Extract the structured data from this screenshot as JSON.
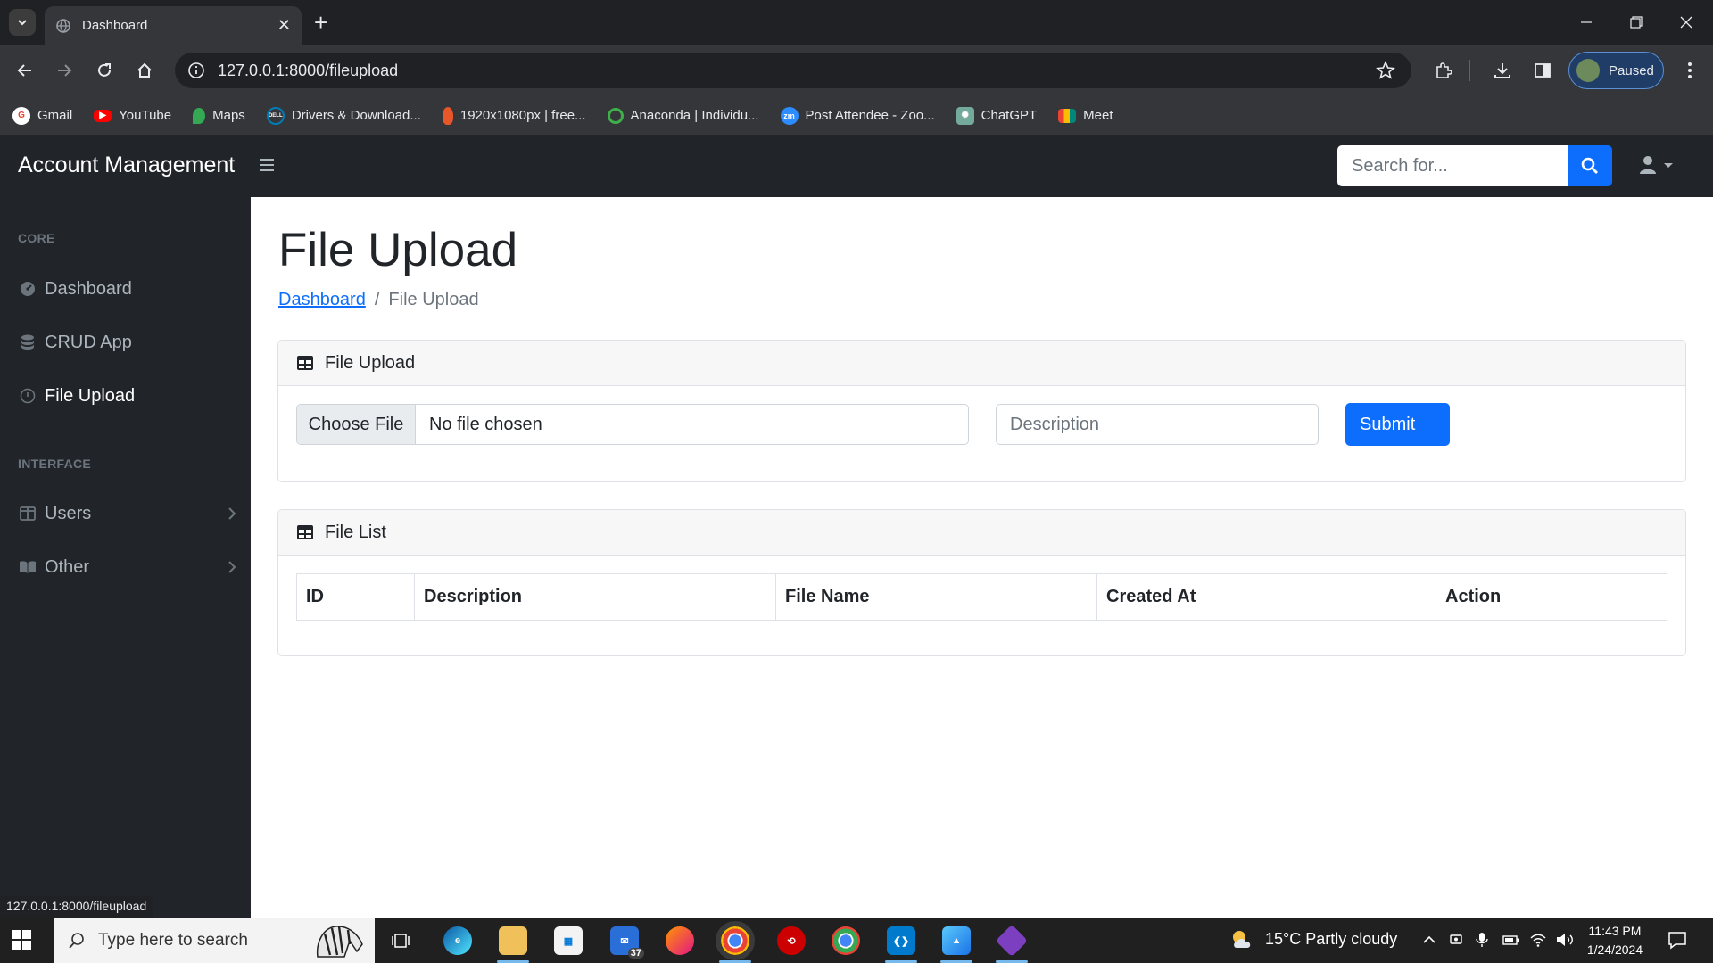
{
  "browser": {
    "tab_title": "Dashboard",
    "url": "127.0.0.1:8000/fileupload",
    "profile_label": "Paused",
    "bookmarks": [
      {
        "label": "Gmail",
        "icon": "google-icon",
        "color": "#ea4335"
      },
      {
        "label": "YouTube",
        "icon": "youtube-icon",
        "color": "#ff0000"
      },
      {
        "label": "Maps",
        "icon": "maps-icon",
        "color": "#34a853"
      },
      {
        "label": "Drivers & Download...",
        "icon": "dell-icon",
        "color": "#007db8"
      },
      {
        "label": "1920x1080px | free...",
        "icon": "wallpaper-icon",
        "color": "#e8572a"
      },
      {
        "label": "Anaconda | Individu...",
        "icon": "anaconda-icon",
        "color": "#3eb049"
      },
      {
        "label": "Post Attendee - Zoo...",
        "icon": "zoom-icon",
        "color": "#2d8cff"
      },
      {
        "label": "ChatGPT",
        "icon": "chatgpt-icon",
        "color": "#74aa9c"
      },
      {
        "label": "Meet",
        "icon": "meet-icon",
        "color": "#00897b"
      }
    ],
    "status_url": "127.0.0.1:8000/fileupload"
  },
  "navbar": {
    "brand": "Account Management",
    "search_placeholder": "Search for..."
  },
  "sidebar": {
    "headings": {
      "core": "CORE",
      "interface": "INTERFACE"
    },
    "core_items": [
      {
        "label": "Dashboard",
        "icon": "tachometer-icon"
      },
      {
        "label": "CRUD App",
        "icon": "database-icon"
      },
      {
        "label": "File Upload",
        "icon": "info-icon",
        "active": true
      }
    ],
    "interface_items": [
      {
        "label": "Users",
        "icon": "columns-icon"
      },
      {
        "label": "Other",
        "icon": "book-icon"
      }
    ]
  },
  "main": {
    "title": "File Upload",
    "breadcrumb": {
      "link": "Dashboard",
      "current": "File Upload"
    },
    "upload_card": {
      "header": "File Upload",
      "choose_file_label": "Choose File",
      "no_file_text": "No file chosen",
      "description_placeholder": "Description",
      "submit_label": "Submit"
    },
    "list_card": {
      "header": "File List",
      "columns": [
        "ID",
        "Description",
        "File Name",
        "Created At",
        "Action"
      ]
    }
  },
  "taskbar": {
    "search_placeholder": "Type here to search",
    "mail_badge": "37",
    "weather": "15°C  Partly cloudy",
    "time": "11:43 PM",
    "date": "1/24/2024"
  },
  "colors": {
    "primary": "#0d6efd",
    "sidebar_bg": "#212529",
    "chrome_dark": "#202124"
  }
}
